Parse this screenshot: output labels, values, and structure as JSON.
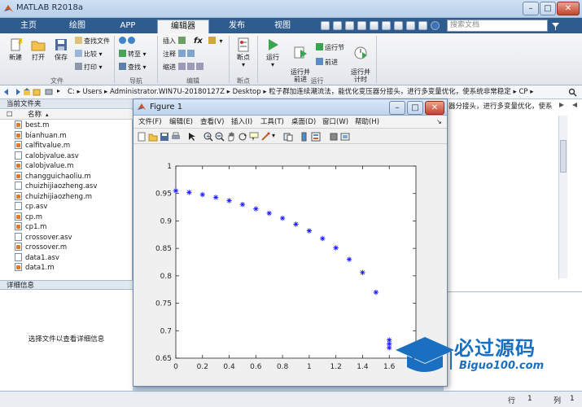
{
  "app": {
    "title": "MATLAB R2018a",
    "tabs": [
      "主页",
      "绘图",
      "APP",
      "编辑器",
      "发布",
      "视图"
    ],
    "active_tab": "编辑器",
    "search_placeholder": "搜索文档"
  },
  "ribbon": {
    "file": {
      "new": "新建",
      "open": "打开",
      "save": "保存",
      "find_files": "查找文件",
      "compare": "比较",
      "print": "打印",
      "label": "文件"
    },
    "navigate": {
      "goto": "转至",
      "find": "查找",
      "label": "导航"
    },
    "edit": {
      "insert": "插入",
      "comment": "注释",
      "indent": "缩进",
      "fx": "fx",
      "label": "编辑"
    },
    "breakpoints": {
      "breakpoints": "断点",
      "label": "断点"
    },
    "run": {
      "run": "运行",
      "run_advance": "运行并\n前进",
      "run_section": "运行节",
      "advance": "前进",
      "run_time": "运行并\n计时",
      "label": "运行"
    }
  },
  "address": {
    "segments": [
      "C:",
      "Users",
      "Administrator.WIN7U-20180127Z",
      "Desktop",
      "粒子群加连续潮流法，能优化变压器分接头，进行多变量优化，使系统非常稳定",
      "CP"
    ]
  },
  "current_folder": {
    "title": "当前文件夹",
    "column": "名称",
    "files": [
      {
        "name": "best.m",
        "type": "m"
      },
      {
        "name": "bianhuan.m",
        "type": "m"
      },
      {
        "name": "calfitvalue.m",
        "type": "m"
      },
      {
        "name": "calobjvalue.asv",
        "type": "asv"
      },
      {
        "name": "calobjvalue.m",
        "type": "m"
      },
      {
        "name": "changguichaoliu.m",
        "type": "m"
      },
      {
        "name": "chuizhijiaozheng.asv",
        "type": "asv"
      },
      {
        "name": "chuizhijiaozheng.m",
        "type": "m"
      },
      {
        "name": "cp.asv",
        "type": "asv"
      },
      {
        "name": "cp.m",
        "type": "m"
      },
      {
        "name": "cp1.m",
        "type": "m"
      },
      {
        "name": "crossover.asv",
        "type": "asv"
      },
      {
        "name": "crossover.m",
        "type": "m"
      },
      {
        "name": "data1.asv",
        "type": "asv"
      },
      {
        "name": "data1.m",
        "type": "m"
      }
    ]
  },
  "details": {
    "title": "详细信息",
    "hint": "选择文件以查看详细信息"
  },
  "right_pane": {
    "overflow_text": "器分接头，进行多变量优化，使系"
  },
  "status": {
    "row_label": "行",
    "row": "1",
    "col_label": "列",
    "col": "1"
  },
  "figure": {
    "title": "Figure 1",
    "menus": [
      "文件(F)",
      "编辑(E)",
      "查看(V)",
      "插入(I)",
      "工具(T)",
      "桌面(D)",
      "窗口(W)",
      "帮助(H)"
    ]
  },
  "watermark": {
    "text": "必过源码",
    "url": "Biguo100.com"
  },
  "chart_data": {
    "type": "scatter",
    "marker": "*",
    "color": "#1a1aff",
    "xlim": [
      0,
      1.8
    ],
    "ylim": [
      0.65,
      1.0
    ],
    "xticks": [
      "0",
      "0.2",
      "0.4",
      "0.6",
      "0.8",
      "1",
      "1.2",
      "1.4",
      "1.6"
    ],
    "yticks": [
      "0.65",
      "0.7",
      "0.75",
      "0.8",
      "0.85",
      "0.9",
      "0.95",
      "1"
    ],
    "points": [
      [
        0.0,
        0.955
      ],
      [
        0.1,
        0.952
      ],
      [
        0.2,
        0.948
      ],
      [
        0.3,
        0.943
      ],
      [
        0.4,
        0.937
      ],
      [
        0.5,
        0.93
      ],
      [
        0.6,
        0.922
      ],
      [
        0.7,
        0.914
      ],
      [
        0.8,
        0.905
      ],
      [
        0.9,
        0.894
      ],
      [
        1.0,
        0.882
      ],
      [
        1.1,
        0.868
      ],
      [
        1.2,
        0.851
      ],
      [
        1.3,
        0.83
      ],
      [
        1.4,
        0.806
      ],
      [
        1.5,
        0.77
      ],
      [
        1.6,
        0.683
      ],
      [
        1.6,
        0.676
      ],
      [
        1.6,
        0.669
      ]
    ],
    "grid": false
  }
}
